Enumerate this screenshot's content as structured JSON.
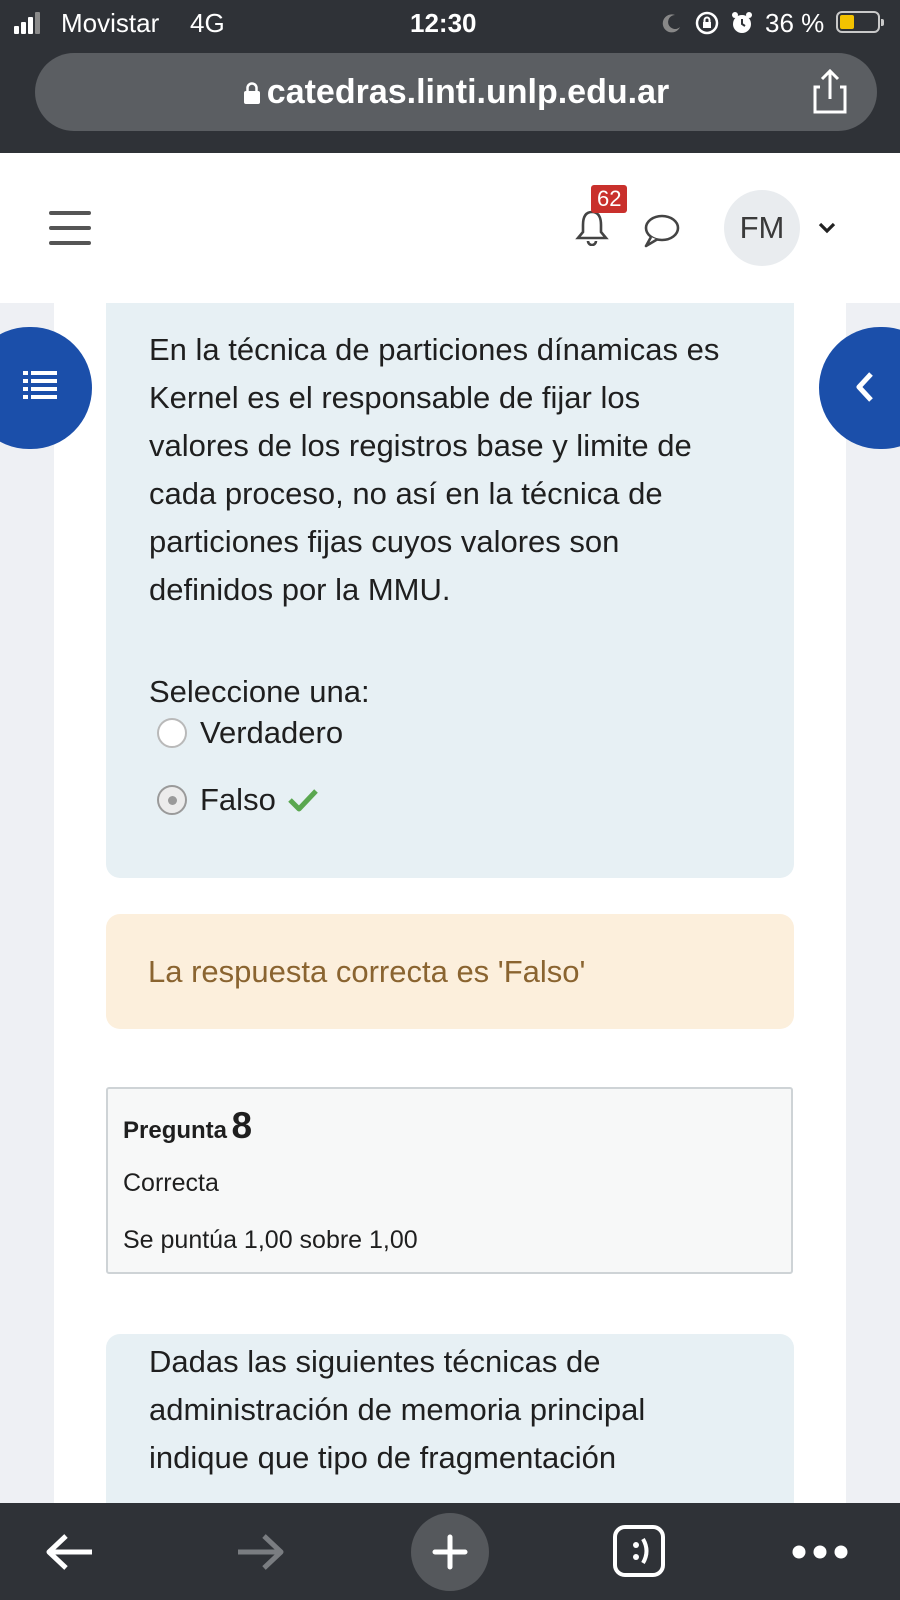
{
  "status_bar": {
    "carrier": "Movistar",
    "network": "4G",
    "time": "12:30",
    "battery": "36 %"
  },
  "browser": {
    "url": "catedras.linti.unlp.edu.ar",
    "icons": [
      "lock-icon",
      "share-icon"
    ]
  },
  "header": {
    "menu_icon": "hamburger-icon",
    "notification_count": "62",
    "avatar_initials": "FM"
  },
  "question": {
    "text_lines": [
      "En la técnica de particiones dínamicas es",
      "Kernel es el responsable de fijar los",
      "valores de los registros base y limite de",
      "cada proceso, no así en la técnica de",
      "particiones fijas cuyos valores son",
      "definidos por la MMU."
    ],
    "prompt": "Seleccione una:",
    "options": [
      {
        "label": "Verdadero",
        "selected": false
      },
      {
        "label": "Falso",
        "selected": true,
        "correct": true
      }
    ]
  },
  "feedback": {
    "text": "La respuesta correcta es 'Falso'"
  },
  "info": {
    "pregunta_label": "Pregunta",
    "pregunta_number": "8",
    "state": "Correcta",
    "grade": "Se puntúa 1,00 sobre 1,00"
  },
  "next_question": {
    "text_lines": [
      "Dadas las siguientes técnicas de",
      "administración de memoria principal",
      "indique que tipo de fragmentación"
    ]
  },
  "colors": {
    "accent_blue": "#1b4faa",
    "correct_green": "#5aa74f",
    "badge_red": "#c9302c",
    "feedback_text": "#8a6430"
  }
}
